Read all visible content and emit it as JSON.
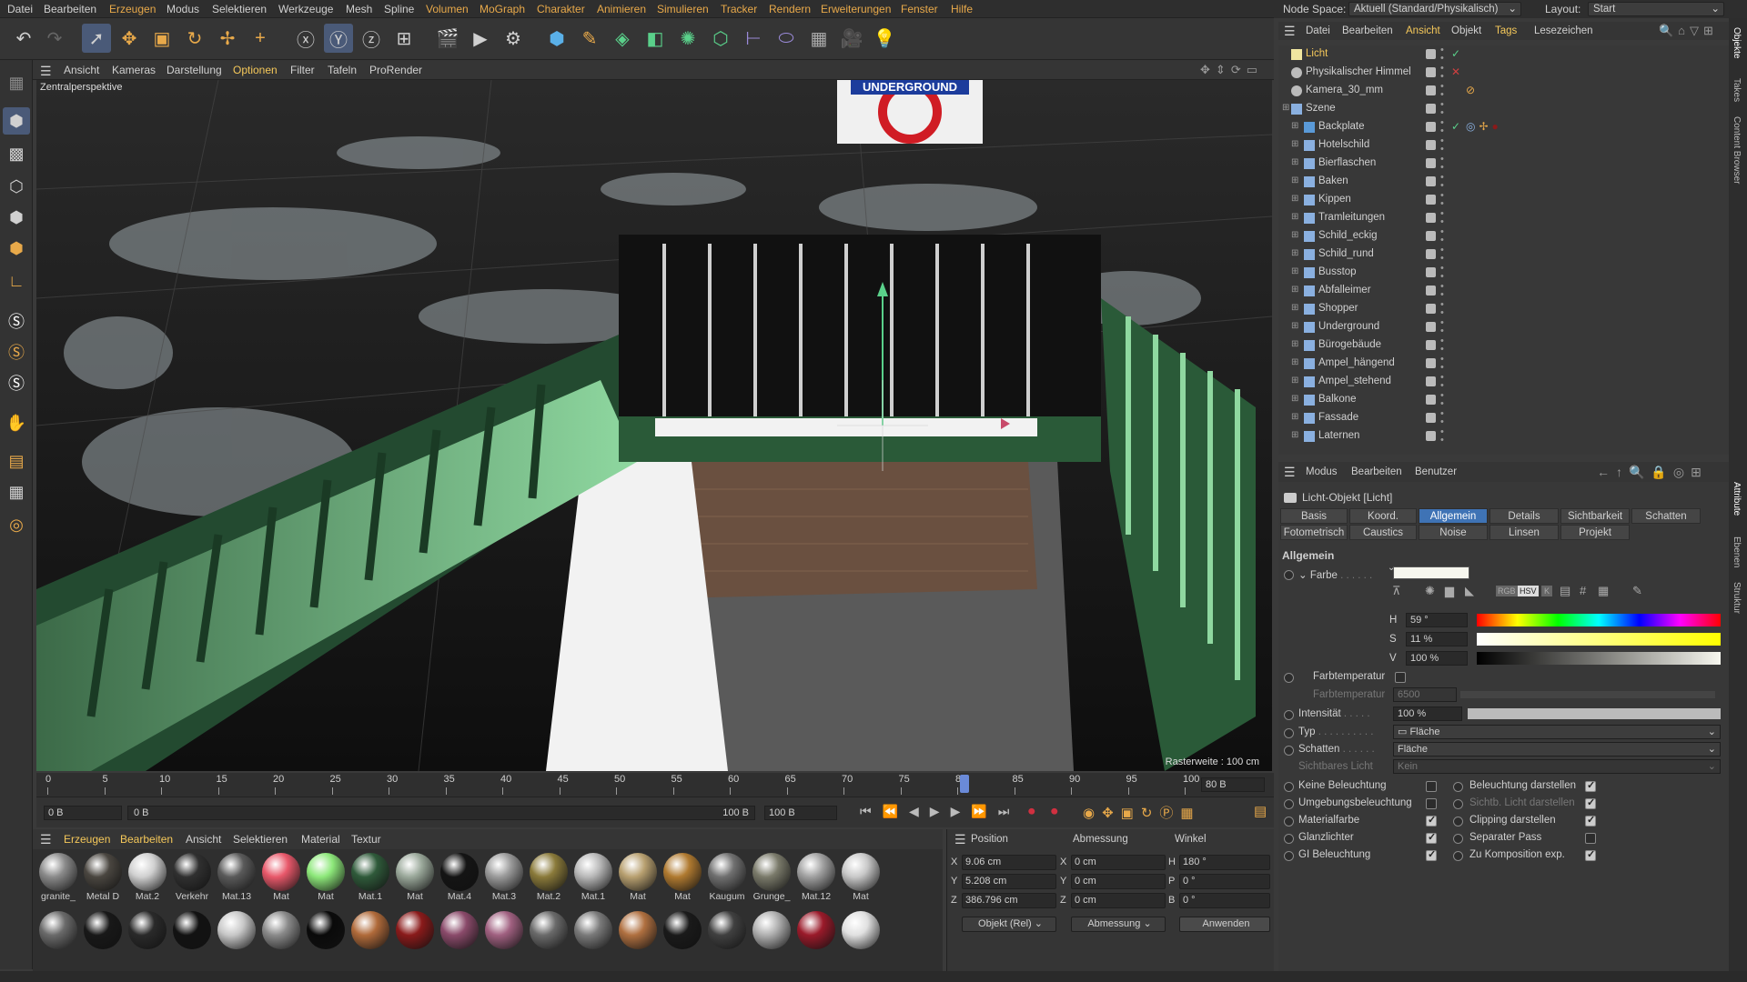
{
  "menubar": {
    "items": [
      "Datei",
      "Bearbeiten",
      "Erzeugen",
      "Modus",
      "Selektieren",
      "Werkzeuge",
      "Mesh",
      "Spline",
      "Volumen",
      "MoGraph",
      "Charakter",
      "Animieren",
      "Simulieren",
      "Tracker",
      "Rendern",
      "Erweiterungen",
      "Fenster",
      "Hilfe"
    ],
    "node_space_label": "Node Space:",
    "node_space_value": "Aktuell (Standard/Physikalisch)",
    "layout_label": "Layout:",
    "layout_value": "Start"
  },
  "viewport": {
    "menu": [
      "Ansicht",
      "Kameras",
      "Darstellung",
      "Optionen",
      "Filter",
      "Tafeln",
      "ProRender"
    ],
    "camera_label": "Zentralperspektive",
    "raster_label": "Rasterweite : 100 cm",
    "sign_text": "UNDERGROUND"
  },
  "timeline": {
    "ticks": [
      "0",
      "5",
      "10",
      "15",
      "20",
      "25",
      "30",
      "35",
      "40",
      "45",
      "50",
      "55",
      "60",
      "65",
      "70",
      "75",
      "80",
      "85",
      "90",
      "95",
      "100"
    ],
    "current_frame": "80 B"
  },
  "playbar": {
    "start": "0 B",
    "min": "0 B",
    "max": "100 B",
    "end": "100 B"
  },
  "materials": {
    "menu": [
      "Erzeugen",
      "Bearbeiten",
      "Ansicht",
      "Selektieren",
      "Material",
      "Textur"
    ],
    "row1": [
      {
        "label": "granite_",
        "color": "#8a8a8a"
      },
      {
        "label": "Metal D",
        "color": "#4a4640"
      },
      {
        "label": "Mat.2",
        "color": "#d0d0d0"
      },
      {
        "label": "Verkehr",
        "color": "#303030"
      },
      {
        "label": "Mat.13",
        "color": "#5a5a5a"
      },
      {
        "label": "Mat",
        "color": "#e8586a"
      },
      {
        "label": "Mat",
        "color": "#8de87a"
      },
      {
        "label": "Mat.1",
        "color": "#2f5a3a"
      },
      {
        "label": "Mat",
        "color": "#9aa89a"
      },
      {
        "label": "Mat.4",
        "color": "#141414"
      },
      {
        "label": "Mat.3",
        "color": "#9a9a9a"
      },
      {
        "label": "Mat.2",
        "color": "#8a7a3a"
      },
      {
        "label": "Mat.1",
        "color": "#b8b8b8"
      },
      {
        "label": "Mat",
        "color": "#b8a070"
      },
      {
        "label": "Mat",
        "color": "#b07a30"
      },
      {
        "label": "Kaugum",
        "color": "#707070"
      },
      {
        "label": "Grunge_",
        "color": "#7a7a6a"
      },
      {
        "label": "Mat.12",
        "color": "#a0a0a0"
      },
      {
        "label": "Mat",
        "color": "#c8c8c8"
      }
    ],
    "row2": [
      "#6a6a6a",
      "#181818",
      "#2a2a2a",
      "#121212",
      "#c8c8c8",
      "#8a8a8a",
      "#0a0a0a",
      "#b06a3a",
      "#8a1a1a",
      "#8a4a6a",
      "#a06080",
      "#6a6a6a",
      "#7a7a7a",
      "#b07040",
      "#1a1a1a",
      "#404040",
      "#b0b0b0",
      "#9a1a2a",
      "#e0e0e0"
    ]
  },
  "coords": {
    "headers": [
      "Position",
      "Abmessung",
      "Winkel"
    ],
    "pos": {
      "x": "9.06 cm",
      "y": "5.208 cm",
      "z": "386.796 cm"
    },
    "size": {
      "x": "0 cm",
      "y": "0 cm",
      "z": "0 cm"
    },
    "rot": {
      "h": "180 °",
      "p": "0 °",
      "b": "0 °"
    },
    "axis_x": "X",
    "axis_y": "Y",
    "axis_z": "Z",
    "axis_h": "H",
    "axis_p": "P",
    "axis_b": "B",
    "mode1": "Objekt (Rel)",
    "mode2": "Abmessung",
    "apply": "Anwenden"
  },
  "objmanager": {
    "menu": [
      "Datei",
      "Bearbeiten",
      "Ansicht",
      "Objekt",
      "Tags",
      "Lesezeichen"
    ],
    "objects": [
      "Licht",
      "Physikalischer Himmel",
      "Kamera_30_mm",
      "Szene",
      "Backplate",
      "Hotelschild",
      "Bierflaschen",
      "Baken",
      "Kippen",
      "Tramleitungen",
      "Schild_eckig",
      "Schild_rund",
      "Busstop",
      "Abfalleimer",
      "Shopper",
      "Underground",
      "Bürogebäude",
      "Ampel_hängend",
      "Ampel_stehend",
      "Balkone",
      "Fassade",
      "Laternen"
    ]
  },
  "attributes": {
    "menu": [
      "Modus",
      "Bearbeiten",
      "Benutzer"
    ],
    "title": "Licht-Objekt [Licht]",
    "tabs_row1": [
      "Basis",
      "Koord.",
      "Allgemein",
      "Details",
      "Sichtbarkeit",
      "Schatten"
    ],
    "tabs_row2": [
      "Fotometrisch",
      "Caustics",
      "Noise",
      "Linsen",
      "Projekt"
    ],
    "section": "Allgemein",
    "farbe_label": "Farbe",
    "h_label": "H",
    "h": "59 °",
    "s_label": "S",
    "s": "11 %",
    "v_label": "V",
    "v": "100 %",
    "farbtemp_label": "Farbtemperatur",
    "farbtemp_value": "6500",
    "intensitaet_label": "Intensität",
    "intensitaet": "100 %",
    "typ_label": "Typ",
    "typ": "Fläche",
    "schatten_label": "Schatten",
    "schatten": "Fläche",
    "sichtbar_label": "Sichtbares Licht",
    "sichtbar": "Kein",
    "left_checks": [
      "Keine Beleuchtung",
      "Umgebungsbeleuchtung",
      "Materialfarbe",
      "Glanzlichter",
      "GI Beleuchtung"
    ],
    "right_checks": [
      "Beleuchtung darstellen",
      "Sichtb. Licht darstellen",
      "Clipping darstellen",
      "Separater Pass",
      "Zu Komposition exp."
    ],
    "color_mode_labels": [
      "RGB",
      "HSV",
      "K"
    ]
  },
  "sidetabs": [
    "Objekte",
    "Takes",
    "Content Browser",
    "Attribute",
    "Ebenen",
    "Struktur"
  ]
}
